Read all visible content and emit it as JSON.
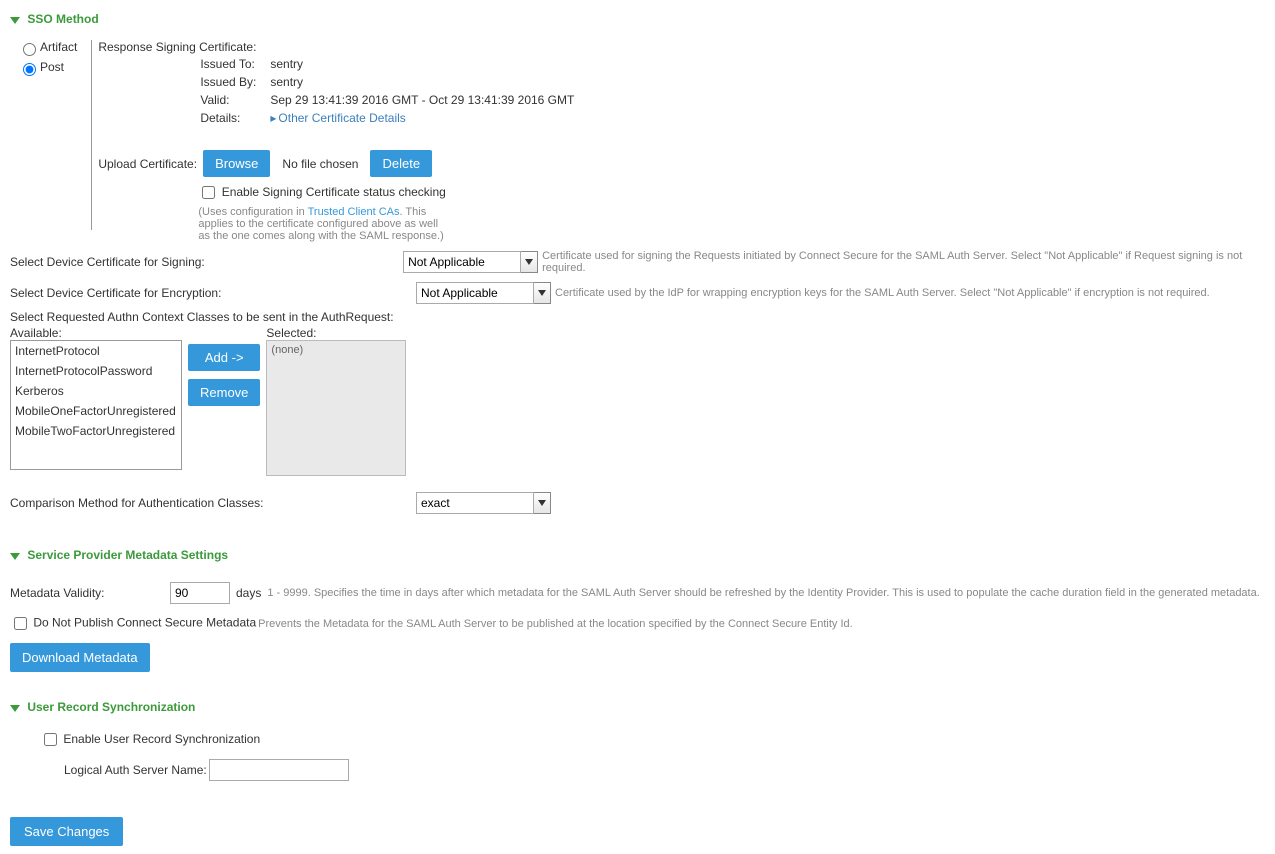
{
  "sections": {
    "sso_method": "SSO Method",
    "sp_meta": "Service Provider Metadata Settings",
    "user_sync": "User Record Synchronization"
  },
  "sso": {
    "artifact_label": "Artifact",
    "post_label": "Post",
    "cert_header": "Response Signing Certificate:",
    "issued_to_label": "Issued To:",
    "issued_to_value": "sentry",
    "issued_by_label": "Issued By:",
    "issued_by_value": "sentry",
    "valid_label": "Valid:",
    "valid_value": "Sep 29 13:41:39 2016 GMT - Oct 29 13:41:39 2016 GMT",
    "details_label": "Details:",
    "details_link": "Other Certificate Details",
    "upload_label": "Upload Certificate:",
    "browse": "Browse",
    "no_file": "No file chosen",
    "delete": "Delete",
    "enable_signing": "Enable Signing Certificate status checking",
    "uses_config_pre": "(Uses configuration in ",
    "uses_config_link": "Trusted Client CAs",
    "uses_config_post": ". This applies to the certificate configured above as well as the one comes along with the SAML response.)"
  },
  "signing": {
    "label": "Select Device Certificate for Signing:",
    "value": "Not Applicable",
    "help": "Certificate used for signing the Requests initiated by Connect Secure for the SAML Auth Server. Select \"Not Applicable\" if Request signing is not required."
  },
  "encryption": {
    "label": "Select Device Certificate for Encryption:",
    "value": "Not Applicable",
    "help": "Certificate used by the IdP for wrapping encryption keys for the SAML Auth Server. Select \"Not Applicable\" if encryption is not required."
  },
  "authn": {
    "label": "Select Requested Authn Context Classes to be sent in the AuthRequest:",
    "available_label": "Available:",
    "selected_label": "Selected:",
    "add": "Add ->",
    "remove": "Remove",
    "none": "(none)",
    "options": {
      "0": "InternetProtocol",
      "1": "InternetProtocolPassword",
      "2": "Kerberos",
      "3": "MobileOneFactorUnregistered",
      "4": "MobileTwoFactorUnregistered"
    }
  },
  "comparison": {
    "label": "Comparison Method for Authentication Classes:",
    "value": "exact"
  },
  "metadata": {
    "validity_label": "Metadata Validity:",
    "validity_value": "90",
    "days": "days",
    "validity_help": "1 - 9999. Specifies the time in days after which metadata for the SAML Auth Server should be refreshed by the Identity Provider. This is used to populate the cache duration field in the generated metadata.",
    "publish_label": "Do Not Publish Connect Secure Metadata",
    "publish_help": "Prevents the Metadata for the SAML Auth Server to be published at the location specified by the Connect Secure Entity Id.",
    "download": "Download Metadata"
  },
  "usersync": {
    "enable": "Enable User Record Synchronization",
    "logical_name_label": "Logical Auth Server Name:"
  },
  "save": "Save Changes"
}
